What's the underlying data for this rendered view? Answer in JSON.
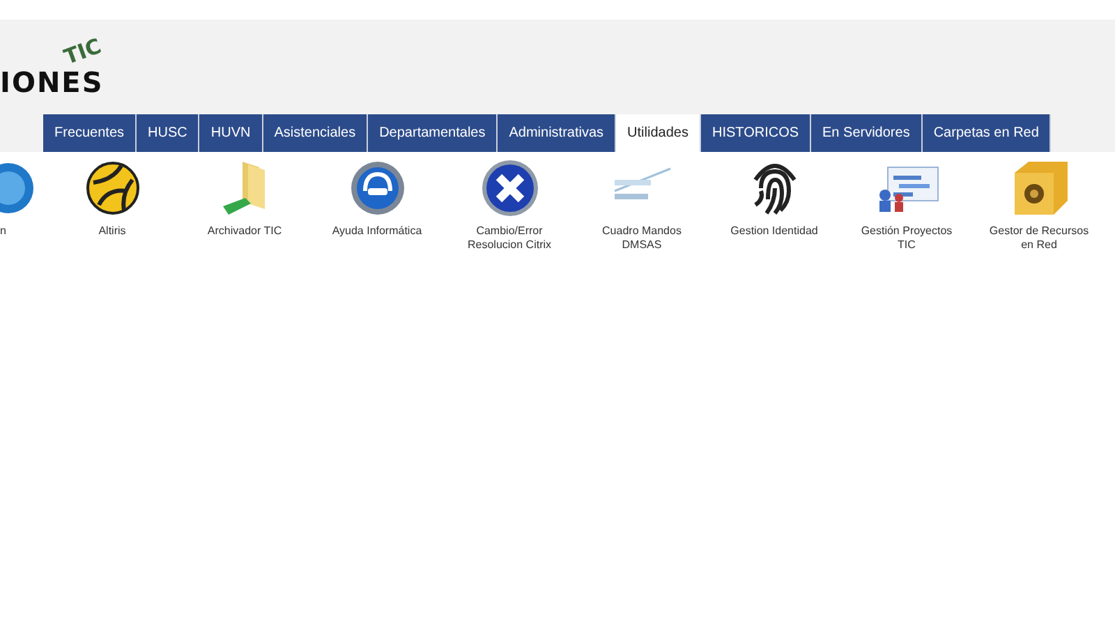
{
  "logo": {
    "text": "IONES",
    "superscript": "TIC"
  },
  "tabs": [
    {
      "label": "Frecuentes",
      "selected": false
    },
    {
      "label": "HUSC",
      "selected": false
    },
    {
      "label": "HUVN",
      "selected": false
    },
    {
      "label": "Asistenciales",
      "selected": false
    },
    {
      "label": "Departamentales",
      "selected": false
    },
    {
      "label": "Administrativas",
      "selected": false
    },
    {
      "label": "Utilidades",
      "selected": true
    },
    {
      "label": "HISTORICOS",
      "selected": false
    },
    {
      "label": "En Servidores",
      "selected": false
    },
    {
      "label": "Carpetas en Red",
      "selected": false
    }
  ],
  "apps": [
    {
      "label": "n",
      "kind": "globe"
    },
    {
      "label": "Altiris",
      "kind": "ball"
    },
    {
      "label": "Archivador TIC",
      "kind": "folder"
    },
    {
      "label": "Ayuda Informática",
      "kind": "headset"
    },
    {
      "label": "Cambio/Error Resolucion Citrix",
      "kind": "x"
    },
    {
      "label": "Cuadro Mandos DMSAS",
      "kind": "dashboard"
    },
    {
      "label": "Gestion Identidad",
      "kind": "fingerprint"
    },
    {
      "label": "Gestión Proyectos TIC",
      "kind": "chart"
    },
    {
      "label": "Gestor de Recursos en Red",
      "kind": "safe"
    }
  ]
}
